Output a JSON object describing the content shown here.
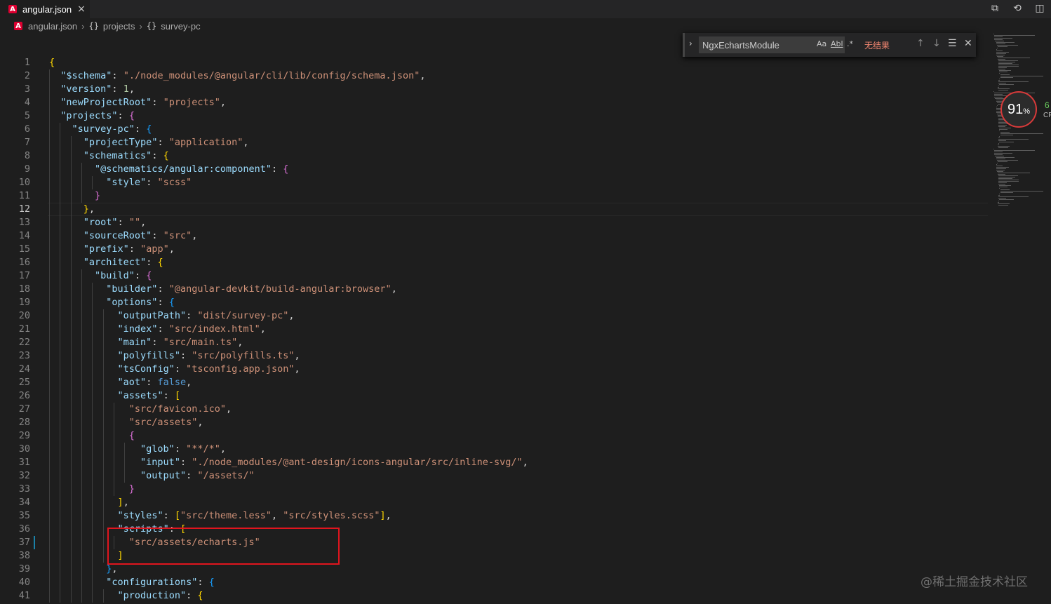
{
  "tab": {
    "title": "angular.json",
    "close_icon": "×",
    "file_icon": "A"
  },
  "toolbar": {
    "compare_icon": "⧉",
    "history_icon": "⟲",
    "split_icon": "◫"
  },
  "breadcrumb": [
    {
      "label": "angular.json"
    },
    {
      "label": "projects"
    },
    {
      "label": "survey-pc"
    }
  ],
  "breadcrumb_symbol": "{}",
  "find": {
    "query": "NgxEchartsModule",
    "match_case": "Aa",
    "whole_word": "Abl",
    "regex": ".*",
    "result": "无结果",
    "prev_icon": "↑",
    "next_icon": "↓",
    "selection_icon": "☰",
    "close_icon": "✕",
    "expand_icon": "›"
  },
  "cpu": {
    "value": "91",
    "unit": "%",
    "side_top": "6",
    "side_bottom": "CP"
  },
  "watermark": "@稀土掘金技术社区",
  "editor": {
    "active_line": 12,
    "lines": [
      [
        [
          "{",
          "y"
        ]
      ],
      [
        [
          "  ",
          ""
        ],
        [
          "\"$schema\"",
          "k"
        ],
        [
          ": ",
          "p"
        ],
        [
          "\"./node_modules/@angular/cli/lib/config/schema.json\"",
          "s"
        ],
        [
          ",",
          "p"
        ]
      ],
      [
        [
          "  ",
          ""
        ],
        [
          "\"version\"",
          "k"
        ],
        [
          ": ",
          "p"
        ],
        [
          "1",
          "n"
        ],
        [
          ",",
          "p"
        ]
      ],
      [
        [
          "  ",
          ""
        ],
        [
          "\"newProjectRoot\"",
          "k"
        ],
        [
          ": ",
          "p"
        ],
        [
          "\"projects\"",
          "s"
        ],
        [
          ",",
          "p"
        ]
      ],
      [
        [
          "  ",
          ""
        ],
        [
          "\"projects\"",
          "k"
        ],
        [
          ": ",
          "p"
        ],
        [
          "{",
          "m"
        ]
      ],
      [
        [
          "    ",
          ""
        ],
        [
          "\"survey-pc\"",
          "k"
        ],
        [
          ": ",
          "p"
        ],
        [
          "{",
          "c"
        ]
      ],
      [
        [
          "      ",
          ""
        ],
        [
          "\"projectType\"",
          "k"
        ],
        [
          ": ",
          "p"
        ],
        [
          "\"application\"",
          "s"
        ],
        [
          ",",
          "p"
        ]
      ],
      [
        [
          "      ",
          ""
        ],
        [
          "\"schematics\"",
          "k"
        ],
        [
          ": ",
          "p"
        ],
        [
          "{",
          "y"
        ]
      ],
      [
        [
          "        ",
          ""
        ],
        [
          "\"@schematics/angular:component\"",
          "k"
        ],
        [
          ": ",
          "p"
        ],
        [
          "{",
          "m"
        ]
      ],
      [
        [
          "          ",
          ""
        ],
        [
          "\"style\"",
          "k"
        ],
        [
          ": ",
          "p"
        ],
        [
          "\"scss\"",
          "s"
        ]
      ],
      [
        [
          "        ",
          ""
        ],
        [
          "}",
          "m"
        ]
      ],
      [
        [
          "      ",
          ""
        ],
        [
          "}",
          "y"
        ],
        [
          ",",
          "p"
        ]
      ],
      [
        [
          "      ",
          ""
        ],
        [
          "\"root\"",
          "k"
        ],
        [
          ": ",
          "p"
        ],
        [
          "\"\"",
          "s"
        ],
        [
          ",",
          "p"
        ]
      ],
      [
        [
          "      ",
          ""
        ],
        [
          "\"sourceRoot\"",
          "k"
        ],
        [
          ": ",
          "p"
        ],
        [
          "\"src\"",
          "s"
        ],
        [
          ",",
          "p"
        ]
      ],
      [
        [
          "      ",
          ""
        ],
        [
          "\"prefix\"",
          "k"
        ],
        [
          ": ",
          "p"
        ],
        [
          "\"app\"",
          "s"
        ],
        [
          ",",
          "p"
        ]
      ],
      [
        [
          "      ",
          ""
        ],
        [
          "\"architect\"",
          "k"
        ],
        [
          ": ",
          "p"
        ],
        [
          "{",
          "y"
        ]
      ],
      [
        [
          "        ",
          ""
        ],
        [
          "\"build\"",
          "k"
        ],
        [
          ": ",
          "p"
        ],
        [
          "{",
          "m"
        ]
      ],
      [
        [
          "          ",
          ""
        ],
        [
          "\"builder\"",
          "k"
        ],
        [
          ": ",
          "p"
        ],
        [
          "\"@angular-devkit/build-angular:browser\"",
          "s"
        ],
        [
          ",",
          "p"
        ]
      ],
      [
        [
          "          ",
          ""
        ],
        [
          "\"options\"",
          "k"
        ],
        [
          ": ",
          "p"
        ],
        [
          "{",
          "c"
        ]
      ],
      [
        [
          "            ",
          ""
        ],
        [
          "\"outputPath\"",
          "k"
        ],
        [
          ": ",
          "p"
        ],
        [
          "\"dist/survey-pc\"",
          "s"
        ],
        [
          ",",
          "p"
        ]
      ],
      [
        [
          "            ",
          ""
        ],
        [
          "\"index\"",
          "k"
        ],
        [
          ": ",
          "p"
        ],
        [
          "\"src/index.html\"",
          "s"
        ],
        [
          ",",
          "p"
        ]
      ],
      [
        [
          "            ",
          ""
        ],
        [
          "\"main\"",
          "k"
        ],
        [
          ": ",
          "p"
        ],
        [
          "\"src/main.ts\"",
          "s"
        ],
        [
          ",",
          "p"
        ]
      ],
      [
        [
          "            ",
          ""
        ],
        [
          "\"polyfills\"",
          "k"
        ],
        [
          ": ",
          "p"
        ],
        [
          "\"src/polyfills.ts\"",
          "s"
        ],
        [
          ",",
          "p"
        ]
      ],
      [
        [
          "            ",
          ""
        ],
        [
          "\"tsConfig\"",
          "k"
        ],
        [
          ": ",
          "p"
        ],
        [
          "\"tsconfig.app.json\"",
          "s"
        ],
        [
          ",",
          "p"
        ]
      ],
      [
        [
          "            ",
          ""
        ],
        [
          "\"aot\"",
          "k"
        ],
        [
          ": ",
          "p"
        ],
        [
          "false",
          "b"
        ],
        [
          ",",
          "p"
        ]
      ],
      [
        [
          "            ",
          ""
        ],
        [
          "\"assets\"",
          "k"
        ],
        [
          ": ",
          "p"
        ],
        [
          "[",
          "y"
        ]
      ],
      [
        [
          "              ",
          ""
        ],
        [
          "\"src/favicon.ico\"",
          "s"
        ],
        [
          ",",
          "p"
        ]
      ],
      [
        [
          "              ",
          ""
        ],
        [
          "\"src/assets\"",
          "s"
        ],
        [
          ",",
          "p"
        ]
      ],
      [
        [
          "              ",
          ""
        ],
        [
          "{",
          "m"
        ]
      ],
      [
        [
          "                ",
          ""
        ],
        [
          "\"glob\"",
          "k"
        ],
        [
          ": ",
          "p"
        ],
        [
          "\"**/*\"",
          "s"
        ],
        [
          ",",
          "p"
        ]
      ],
      [
        [
          "                ",
          ""
        ],
        [
          "\"input\"",
          "k"
        ],
        [
          ": ",
          "p"
        ],
        [
          "\"./node_modules/@ant-design/icons-angular/src/inline-svg/\"",
          "s"
        ],
        [
          ",",
          "p"
        ]
      ],
      [
        [
          "                ",
          ""
        ],
        [
          "\"output\"",
          "k"
        ],
        [
          ": ",
          "p"
        ],
        [
          "\"/assets/\"",
          "s"
        ]
      ],
      [
        [
          "              ",
          ""
        ],
        [
          "}",
          "m"
        ]
      ],
      [
        [
          "            ",
          ""
        ],
        [
          "]",
          "y"
        ],
        [
          ",",
          "p"
        ]
      ],
      [
        [
          "            ",
          ""
        ],
        [
          "\"styles\"",
          "k"
        ],
        [
          ": ",
          "p"
        ],
        [
          "[",
          "y"
        ],
        [
          "\"src/theme.less\"",
          "s"
        ],
        [
          ", ",
          "p"
        ],
        [
          "\"src/styles.scss\"",
          "s"
        ],
        [
          "]",
          "y"
        ],
        [
          ",",
          "p"
        ]
      ],
      [
        [
          "            ",
          ""
        ],
        [
          "\"scripts\"",
          "k"
        ],
        [
          ": ",
          "p"
        ],
        [
          "[",
          "y"
        ]
      ],
      [
        [
          "              ",
          ""
        ],
        [
          "\"src/assets/echarts.js\"",
          "s"
        ]
      ],
      [
        [
          "            ",
          ""
        ],
        [
          "]",
          "y"
        ]
      ],
      [
        [
          "          ",
          ""
        ],
        [
          "}",
          "c"
        ],
        [
          ",",
          "p"
        ]
      ],
      [
        [
          "          ",
          ""
        ],
        [
          "\"configurations\"",
          "k"
        ],
        [
          ": ",
          "p"
        ],
        [
          "{",
          "c"
        ]
      ],
      [
        [
          "            ",
          ""
        ],
        [
          "\"production\"",
          "k"
        ],
        [
          ": ",
          "p"
        ],
        [
          "{",
          "y"
        ]
      ]
    ]
  }
}
